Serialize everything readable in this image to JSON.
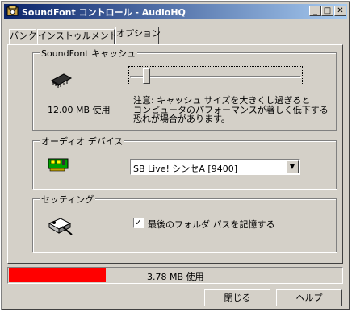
{
  "window": {
    "title": "SoundFont コントロール - AudioHQ"
  },
  "titlebar_buttons": {
    "minimize": "_",
    "maximize": "□",
    "close": "✕"
  },
  "tabs": [
    {
      "label": "バンク"
    },
    {
      "label": "インストゥルメント"
    },
    {
      "label": "オプション",
      "active": true
    }
  ],
  "cache_group": {
    "label": "SoundFont キャッシュ",
    "size_text": "12.00 MB 使用",
    "slider_value_percent": 8,
    "note_lines": [
      "注意: キャッシュ サイズを大きくし過ぎると",
      "コンピュータのパフォーマンスが著しく低下する",
      "恐れが場合があります。"
    ]
  },
  "audio_group": {
    "label": "オーディオ デバイス",
    "device_selected": "SB Live! シンセA [9400]"
  },
  "settings_group": {
    "label": "セッティング",
    "remember_folder_label": "最後のフォルダ パスを記憶する",
    "remember_folder_checked": true
  },
  "status": {
    "usage_text": "3.78 MB 使用",
    "usage_fill_percent": 29
  },
  "buttons": {
    "close": "閉じる",
    "help": "ヘルプ"
  },
  "colors": {
    "titlebar_start": "#0a246a",
    "titlebar_end": "#a6caf0",
    "usage_bar": "#ff0000"
  }
}
